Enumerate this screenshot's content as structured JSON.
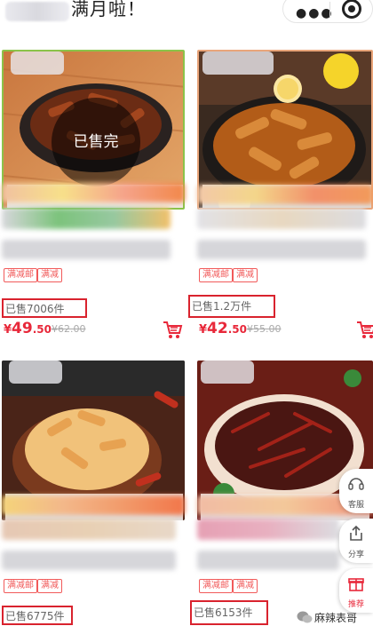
{
  "header": {
    "title_visible": "满月啦！"
  },
  "products": [
    {
      "tags": [
        "满减邮",
        "满减"
      ],
      "sold": "已售7006件",
      "price_int": "49",
      "price_dec": ".50",
      "yen": "¥",
      "original": "¥62.00",
      "overlay": "已售完"
    },
    {
      "tags": [
        "满减邮",
        "满减"
      ],
      "sold": "已售1.2万件",
      "price_int": "42",
      "price_dec": ".50",
      "yen": "¥",
      "original": "¥55.00"
    },
    {
      "tags": [
        "满减邮",
        "满减"
      ],
      "sold": "已售6775件"
    },
    {
      "tags": [
        "满减邮",
        "满减"
      ],
      "sold": "已售6153件"
    }
  ],
  "floating": {
    "service": "客服",
    "share": "分享",
    "recommend": "推荐"
  },
  "watermark": {
    "text": "麻辣表哥"
  },
  "colors": {
    "accent": "#e8283a",
    "highlight_box": "#d9232e"
  }
}
